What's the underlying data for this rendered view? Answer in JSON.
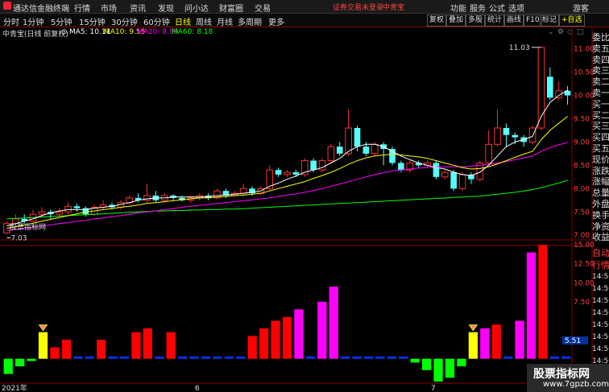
{
  "app": {
    "name": "通达信金融终端",
    "menus": [
      "行情",
      "市场",
      "资讯",
      "发现",
      "问小达",
      "财富圈",
      "交易"
    ],
    "login_text": "证券交易未登录",
    "stock_tab": "中青宝",
    "window_buttons": [
      "功能",
      "服务",
      "公式",
      "选项",
      "游客"
    ]
  },
  "toolbar": {
    "periods": [
      "分时",
      "1分钟",
      "5分钟",
      "15分钟",
      "30分钟",
      "60分钟",
      "日线",
      "周线",
      "月线",
      "多周期",
      "更多"
    ],
    "active_period": "日线",
    "buttons": [
      "复权",
      "叠加",
      "多股",
      "统计",
      "画线",
      "F10",
      "标记",
      "+自选"
    ]
  },
  "legend": {
    "title": "中青宝(日线 前复权)",
    "ma5": "MA5: 10.11",
    "ma10": "MA10: 9.55",
    "ma20": "MA20: 8.99",
    "ma60": "MA60: 8.18",
    "ma5_color": "#ffffff",
    "ma10_color": "#ffff00",
    "ma20_color": "#ff00ff",
    "ma60_color": "#00ff00"
  },
  "indicator": {
    "title": "股票指标网"
  },
  "x_labels": [
    "2021年",
    "6",
    "7"
  ],
  "right_panel": {
    "top_labels": [
      "委比",
      "卖五",
      "卖四",
      "卖三",
      "卖二",
      "卖一",
      "买一",
      "买二",
      "买三",
      "买四",
      "买五",
      "现价",
      "涨跌",
      "涨幅",
      "总量",
      "外盘",
      "换手",
      "净资",
      "收益"
    ],
    "bottom_labels": [
      "自动",
      "行情",
      "14:50",
      "14:50",
      "14:50",
      "14:50",
      "14:50",
      "14:50",
      "14:50",
      "14:50",
      "14:50"
    ]
  },
  "watermark": {
    "line1": "股票指标网",
    "line2": "www.7gpzb.com"
  },
  "chart_data": [
    {
      "type": "candlestick",
      "ylim": [
        6.9,
        11.2
      ],
      "y_ticks": [
        7.0,
        7.5,
        8.0,
        8.5,
        9.0,
        9.5,
        10.0,
        10.5,
        11.0
      ],
      "annotations": {
        "high": "11.03",
        "low": "7.03"
      },
      "candles": [
        [
          7.05,
          7.25,
          7.3,
          7.03
        ],
        [
          7.25,
          7.35,
          7.45,
          7.2
        ],
        [
          7.35,
          7.3,
          7.45,
          7.25
        ],
        [
          7.3,
          7.45,
          7.55,
          7.28
        ],
        [
          7.45,
          7.5,
          7.6,
          7.4
        ],
        [
          7.5,
          7.45,
          7.55,
          7.35
        ],
        [
          7.45,
          7.5,
          7.58,
          7.4
        ],
        [
          7.5,
          7.62,
          7.7,
          7.45
        ],
        [
          7.62,
          7.58,
          7.68,
          7.5
        ],
        [
          7.58,
          7.45,
          7.62,
          7.4
        ],
        [
          7.45,
          7.6,
          7.65,
          7.42
        ],
        [
          7.6,
          7.65,
          7.75,
          7.55
        ],
        [
          7.65,
          7.6,
          7.7,
          7.55
        ],
        [
          7.6,
          7.7,
          7.75,
          7.55
        ],
        [
          7.7,
          7.8,
          7.85,
          7.65
        ],
        [
          7.8,
          7.75,
          7.9,
          7.7
        ],
        [
          7.75,
          7.85,
          8.1,
          7.7
        ],
        [
          7.85,
          7.75,
          7.95,
          7.7
        ],
        [
          7.75,
          7.85,
          7.9,
          7.7
        ],
        [
          7.85,
          7.8,
          7.88,
          7.75
        ],
        [
          7.8,
          7.75,
          7.85,
          7.72
        ],
        [
          7.75,
          7.8,
          7.85,
          7.7
        ],
        [
          7.8,
          7.85,
          7.9,
          7.75
        ],
        [
          7.85,
          7.8,
          7.9,
          7.75
        ],
        [
          7.8,
          7.95,
          8.0,
          7.78
        ],
        [
          7.95,
          7.85,
          8.0,
          7.8
        ],
        [
          7.85,
          7.9,
          7.95,
          7.82
        ],
        [
          7.9,
          8.0,
          8.1,
          7.85
        ],
        [
          8.0,
          7.9,
          8.05,
          7.85
        ],
        [
          7.9,
          8.0,
          8.05,
          7.85
        ],
        [
          8.0,
          8.4,
          8.5,
          7.95
        ],
        [
          8.4,
          8.3,
          8.45,
          8.25
        ],
        [
          8.3,
          8.35,
          8.4,
          8.25
        ],
        [
          8.35,
          8.3,
          8.4,
          8.25
        ],
        [
          8.3,
          8.6,
          8.65,
          8.25
        ],
        [
          8.6,
          8.4,
          8.65,
          8.35
        ],
        [
          8.4,
          8.6,
          8.65,
          8.35
        ],
        [
          8.6,
          8.9,
          8.95,
          8.55
        ],
        [
          8.9,
          8.75,
          9.0,
          8.7
        ],
        [
          8.75,
          9.3,
          9.7,
          8.7
        ],
        [
          9.3,
          8.9,
          9.35,
          8.8
        ],
        [
          8.9,
          8.75,
          9.0,
          8.7
        ],
        [
          8.75,
          8.95,
          9.0,
          8.7
        ],
        [
          8.95,
          8.85,
          9.0,
          8.5
        ],
        [
          8.85,
          8.55,
          8.9,
          8.5
        ],
        [
          8.55,
          8.4,
          8.6,
          8.35
        ],
        [
          8.4,
          8.55,
          8.6,
          8.35
        ],
        [
          8.55,
          8.5,
          8.6,
          8.45
        ],
        [
          8.5,
          8.55,
          8.6,
          8.45
        ],
        [
          8.55,
          8.25,
          8.6,
          8.2
        ],
        [
          8.25,
          8.35,
          8.4,
          8.2
        ],
        [
          8.35,
          8.0,
          8.4,
          7.95
        ],
        [
          8.0,
          8.3,
          8.35,
          7.95
        ],
        [
          8.3,
          8.2,
          8.35,
          8.1
        ],
        [
          8.2,
          8.55,
          8.6,
          8.15
        ],
        [
          8.55,
          8.95,
          9.25,
          8.5
        ],
        [
          8.95,
          9.3,
          9.7,
          8.9
        ],
        [
          9.3,
          9.15,
          9.4,
          8.9
        ],
        [
          9.15,
          9.1,
          9.2,
          8.95
        ],
        [
          9.1,
          9.0,
          9.15,
          8.9
        ],
        [
          9.0,
          9.3,
          9.35,
          8.95
        ],
        [
          9.3,
          11.03,
          11.03,
          9.25
        ],
        [
          10.4,
          9.95,
          10.6,
          9.9
        ],
        [
          9.95,
          10.1,
          10.3,
          9.9
        ],
        [
          10.1,
          10.0,
          10.2,
          9.8
        ]
      ],
      "ma": {
        "ma5": [
          7.2,
          7.25,
          7.3,
          7.35,
          7.42,
          7.48,
          7.52,
          7.55,
          7.55,
          7.55,
          7.58,
          7.6,
          7.62,
          7.66,
          7.7,
          7.75,
          7.78,
          7.8,
          7.8,
          7.82,
          7.82,
          7.82,
          7.82,
          7.83,
          7.85,
          7.86,
          7.88,
          7.9,
          7.92,
          7.95,
          8.05,
          8.12,
          8.2,
          8.27,
          8.35,
          8.4,
          8.45,
          8.55,
          8.65,
          8.8,
          8.9,
          8.95,
          8.95,
          8.9,
          8.8,
          8.7,
          8.62,
          8.55,
          8.5,
          8.45,
          8.42,
          8.35,
          8.3,
          8.28,
          8.35,
          8.5,
          8.7,
          8.9,
          9.0,
          9.05,
          9.12,
          9.55,
          9.85,
          10.0,
          10.11
        ],
        "ma10": [
          7.15,
          7.18,
          7.22,
          7.26,
          7.3,
          7.34,
          7.38,
          7.42,
          7.46,
          7.5,
          7.52,
          7.55,
          7.57,
          7.6,
          7.62,
          7.65,
          7.68,
          7.7,
          7.72,
          7.74,
          7.76,
          7.78,
          7.8,
          7.8,
          7.82,
          7.83,
          7.85,
          7.86,
          7.88,
          7.9,
          7.95,
          8.0,
          8.05,
          8.1,
          8.15,
          8.22,
          8.28,
          8.35,
          8.43,
          8.52,
          8.6,
          8.66,
          8.7,
          8.72,
          8.74,
          8.72,
          8.7,
          8.68,
          8.65,
          8.6,
          8.55,
          8.5,
          8.45,
          8.42,
          8.43,
          8.47,
          8.53,
          8.6,
          8.67,
          8.74,
          8.8,
          9.05,
          9.25,
          9.4,
          9.55
        ],
        "ma20": [
          7.1,
          7.12,
          7.15,
          7.17,
          7.2,
          7.22,
          7.25,
          7.27,
          7.3,
          7.32,
          7.35,
          7.37,
          7.4,
          7.42,
          7.45,
          7.48,
          7.5,
          7.52,
          7.55,
          7.57,
          7.6,
          7.62,
          7.64,
          7.66,
          7.68,
          7.7,
          7.72,
          7.74,
          7.76,
          7.78,
          7.8,
          7.83,
          7.86,
          7.89,
          7.92,
          7.96,
          8.0,
          8.05,
          8.1,
          8.15,
          8.2,
          8.25,
          8.3,
          8.34,
          8.38,
          8.4,
          8.42,
          8.44,
          8.45,
          8.46,
          8.47,
          8.47,
          8.47,
          8.48,
          8.5,
          8.52,
          8.55,
          8.58,
          8.62,
          8.66,
          8.7,
          8.8,
          8.88,
          8.94,
          8.99
        ],
        "ma60": [
          7.35,
          7.36,
          7.37,
          7.38,
          7.39,
          7.4,
          7.41,
          7.42,
          7.43,
          7.44,
          7.45,
          7.46,
          7.47,
          7.48,
          7.49,
          7.5,
          7.51,
          7.52,
          7.52,
          7.53,
          7.53,
          7.54,
          7.54,
          7.55,
          7.55,
          7.56,
          7.56,
          7.57,
          7.58,
          7.59,
          7.6,
          7.61,
          7.62,
          7.63,
          7.64,
          7.65,
          7.66,
          7.67,
          7.68,
          7.69,
          7.7,
          7.71,
          7.72,
          7.73,
          7.74,
          7.75,
          7.76,
          7.77,
          7.78,
          7.79,
          7.8,
          7.81,
          7.82,
          7.83,
          7.84,
          7.86,
          7.88,
          7.9,
          7.92,
          7.95,
          7.98,
          8.02,
          8.07,
          8.12,
          8.18
        ]
      }
    },
    {
      "type": "bar",
      "ylim": [
        -3.0,
        16.5
      ],
      "y_ticks": [
        15.0,
        12.5,
        10.0,
        7.5
      ],
      "current_value": "5.51",
      "colors": {
        "neg": "#00ff00",
        "blue": "#0033ff",
        "red": "#ff0000",
        "yellow": "#ffff00",
        "magenta": "#ff00ff"
      },
      "bars": [
        [
          -2.0,
          "neg"
        ],
        [
          -1.0,
          "neg"
        ],
        [
          -0.3,
          "neg"
        ],
        [
          3.5,
          "yellow"
        ],
        [
          1.5,
          "red"
        ],
        [
          2.5,
          "red"
        ],
        [
          0.3,
          "blue"
        ],
        [
          0.3,
          "blue"
        ],
        [
          2.5,
          "red"
        ],
        [
          0.3,
          "blue"
        ],
        [
          0.3,
          "blue"
        ],
        [
          3.5,
          "red"
        ],
        [
          4.0,
          "red"
        ],
        [
          0.3,
          "blue"
        ],
        [
          3.5,
          "red"
        ],
        [
          0.3,
          "blue"
        ],
        [
          0.3,
          "blue"
        ],
        [
          0.3,
          "blue"
        ],
        [
          0.3,
          "blue"
        ],
        [
          0.3,
          "blue"
        ],
        [
          0.3,
          "blue"
        ],
        [
          3.0,
          "red"
        ],
        [
          4.0,
          "red"
        ],
        [
          5.0,
          "red"
        ],
        [
          5.5,
          "red"
        ],
        [
          6.5,
          "magenta"
        ],
        [
          0.3,
          "blue"
        ],
        [
          7.5,
          "magenta"
        ],
        [
          9.5,
          "magenta"
        ],
        [
          0.3,
          "blue"
        ],
        [
          0.3,
          "blue"
        ],
        [
          0.3,
          "blue"
        ],
        [
          0.3,
          "blue"
        ],
        [
          0.3,
          "blue"
        ],
        [
          0.3,
          "blue"
        ],
        [
          -0.5,
          "neg"
        ],
        [
          -1.5,
          "neg"
        ],
        [
          -3.0,
          "neg"
        ],
        [
          -2.5,
          "neg"
        ],
        [
          -1.0,
          "neg"
        ],
        [
          3.5,
          "yellow"
        ],
        [
          4.0,
          "magenta"
        ],
        [
          4.5,
          "red"
        ],
        [
          0.3,
          "blue"
        ],
        [
          5.0,
          "magenta"
        ],
        [
          14.0,
          "magenta"
        ],
        [
          15.0,
          "red"
        ],
        [
          0.3,
          "blue"
        ],
        [
          0.3,
          "blue"
        ]
      ],
      "markers_at": [
        3,
        40
      ]
    }
  ]
}
